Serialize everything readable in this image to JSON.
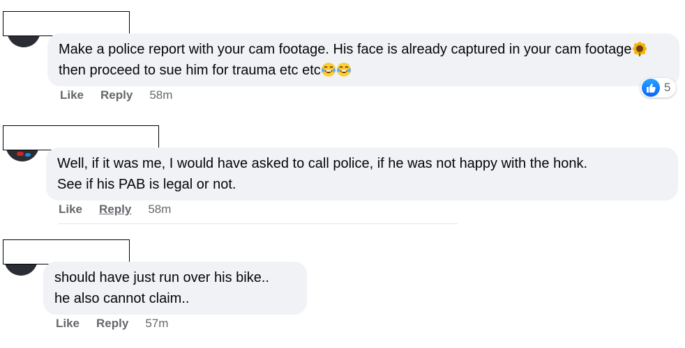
{
  "comments": [
    {
      "text_before_emoji": "Make a police report with your cam footage. His face is already captured in your cam footage",
      "emoji_1": "sunflower-emoji",
      "text_after_emoji": " then proceed to sue him for trauma etc etc",
      "emoji_2": "laughing-tears-emoji",
      "actions": {
        "like": "Like",
        "reply": "Reply",
        "time": "58m"
      },
      "reactions": {
        "icon": "like-icon",
        "count": "5"
      }
    },
    {
      "text": "Well, if it was me, I would have asked to call police, if he was not happy with the honk.\nSee if his PAB is legal or not.",
      "actions": {
        "like": "Like",
        "reply": "Reply",
        "time": "58m"
      }
    },
    {
      "text": "should have just run over his bike..\nhe also cannot claim..",
      "actions": {
        "like": "Like",
        "reply": "Reply",
        "time": "57m"
      }
    }
  ],
  "colors": {
    "bubble": "#f0f2f5",
    "meta_text": "#65676b",
    "like_blue": "#0866ff"
  }
}
